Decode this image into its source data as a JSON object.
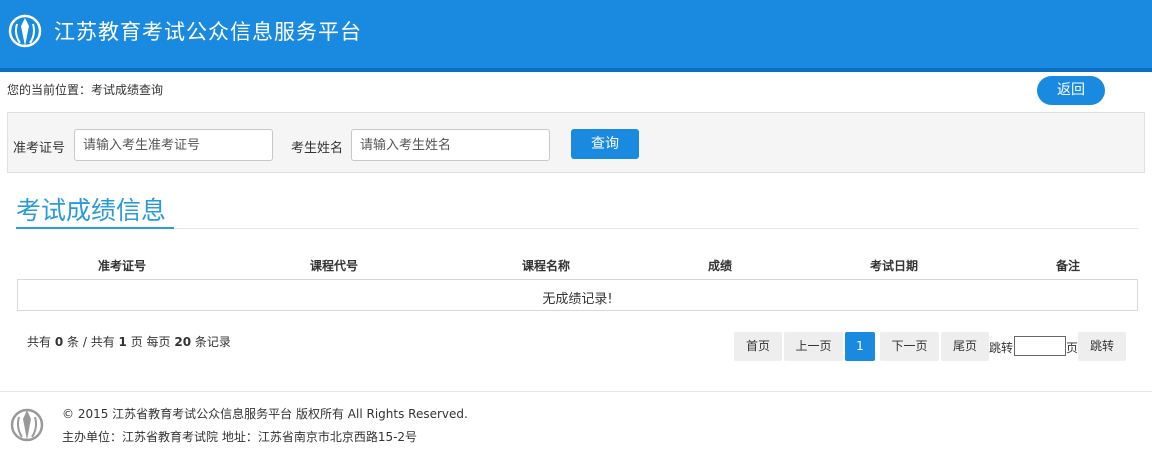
{
  "header": {
    "site_title": "江苏教育考试公众信息服务平台",
    "logo_icon": "education-exam-logo-icon"
  },
  "breadcrumb": {
    "text": "您的当前位置：考试成绩查询"
  },
  "actions": {
    "back_label": "返回"
  },
  "search": {
    "ticket_label": "准考证号",
    "ticket_placeholder": "请输入考生准考证号",
    "ticket_value": "",
    "name_label": "考生姓名",
    "name_placeholder": "请输入考生姓名",
    "name_value": "",
    "query_label": "查询"
  },
  "section": {
    "title": "考试成绩信息"
  },
  "table": {
    "columns": [
      "准考证号",
      "课程代号",
      "课程名称",
      "成绩",
      "考试日期",
      "备注"
    ],
    "rows": [],
    "empty_text": "无成绩记录!"
  },
  "pagination": {
    "sum_prefix": "共有",
    "total_records": "0",
    "sum_records_unit": "条 / 共有",
    "total_pages": "1",
    "sum_pages_unit": "页 每页",
    "per_page": "20",
    "sum_suffix": "条记录",
    "first": "首页",
    "prev": "上一页",
    "current_page": "1",
    "next": "下一页",
    "last": "尾页",
    "jump_label": "跳转",
    "jump_value": "",
    "page_unit": "页",
    "jump_button": "跳转"
  },
  "footer": {
    "copyright": "© 2015 江苏省教育考试公众信息服务平台 版权所有 All Rights Reserved.",
    "host": "主办单位：江苏省教育考试院 地址：江苏省南京市北京西路15-2号"
  },
  "colors": {
    "primary": "#1a8ae0",
    "header_border": "#0d6fc2",
    "section_title": "#2a9ad8",
    "panel_bg": "#f5f5f5"
  }
}
